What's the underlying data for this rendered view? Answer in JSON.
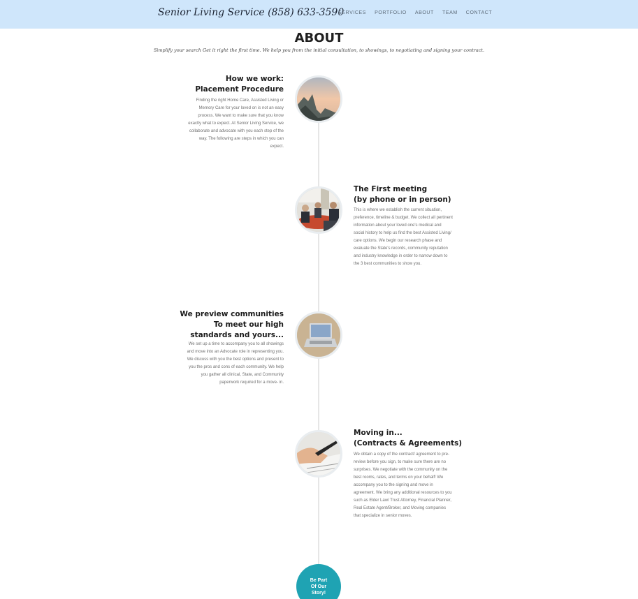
{
  "brand": "Senior Living Service (858) 633-3590",
  "nav": [
    "SERVICES",
    "PORTFOLIO",
    "ABOUT",
    "TEAM",
    "CONTACT"
  ],
  "page": {
    "title": "ABOUT",
    "subtitle": "Simplify your search Get it right the first time. We help you from the initial consultation, to showings, to negotiating and signing your contract."
  },
  "timeline": [
    {
      "heading1": "How we work:",
      "heading2": "Placement Procedure",
      "heading3": "",
      "body": "Finding the right Home Care, Assisted Living or Memory Care for your loved on is not an easy process. We want to make sure that you know exactly what to expect. At Senior Living Service, we collaborate and advocate with you each step of the way. The following are steps in which you can expect.",
      "image": "mountain-sunrise-photo"
    },
    {
      "heading1": "The First meeting",
      "heading2": "(by phone or in person)",
      "heading3": "",
      "body": "This is where we establish the current situation, preference, timeline & budget. We collect all pertinent information about your loved one's medical and social history to help us find the best Assisted Living/ care options. We begin our research phase and evaluate the State's records, community reputation and industry knowledge in order to narrow down to the 3 best communities to show you.",
      "image": "meeting-photo"
    },
    {
      "heading1": "We preview communities",
      "heading2": "To meet our high",
      "heading3": "standards and yours...",
      "body": "We set up a time to accompany you to all showings and move into an Advocate role in representing you. We discuss with you the best options and present to you the pros and cons of each community. We help you gather all clinical, State, and Community paperwork required for a move- in.",
      "image": "laptop-photo"
    },
    {
      "heading1": "Moving in...",
      "heading2": "(Contracts & Agreements)",
      "heading3": "",
      "body": "We obtain a copy of the contract/ agreement to pre-review before you sign, to make sure there are no surprises. We negotiate with the community on the best rooms, rates, and terms on your behalf! We accompany you to the signing and move in agreement. We bring any additional resources to you such as Elder Law/ Trust Attorney, Financial Planner, Real Estate Agent/Broker, and Moving companies that specialize in senior moves.",
      "image": "signing-photo"
    }
  ],
  "cta": [
    "Be Part",
    "Of Our",
    "Story!"
  ],
  "colors": {
    "navbar": "#cfe6fb",
    "accent": "#1fa3b3",
    "timeline": "#e6e6e6"
  }
}
